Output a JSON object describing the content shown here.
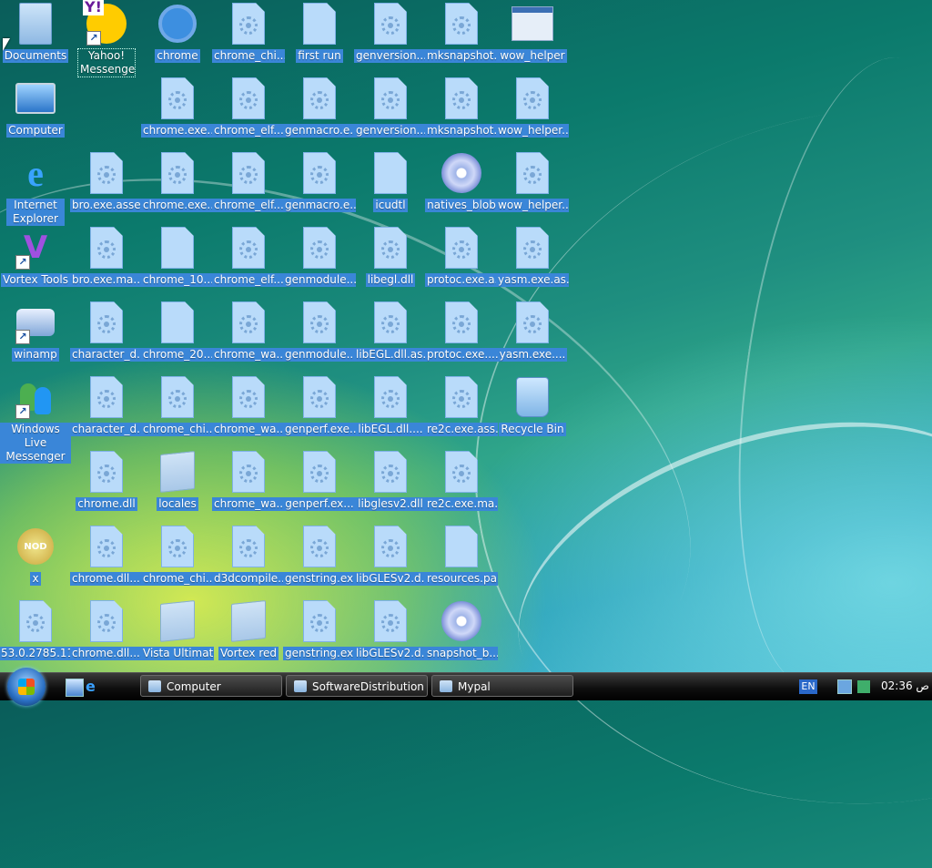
{
  "desktop_icons": [
    {
      "label": "Documents"
    },
    {
      "label": "Computer"
    },
    {
      "label": "Internet Explorer"
    },
    {
      "label": "Vortex Tools"
    },
    {
      "label": "winamp"
    },
    {
      "label": "Windows Live Messenger"
    },
    {
      "label": "x"
    },
    {
      "label": "53.0.2785.11..."
    },
    {
      "label": "Yahoo! Messenger"
    },
    {
      "label": "bro.exe.asse..."
    },
    {
      "label": "bro.exe.ma..."
    },
    {
      "label": "character_d..."
    },
    {
      "label": "character_d..."
    },
    {
      "label": "chrome.dll"
    },
    {
      "label": "chrome.dll...."
    },
    {
      "label": "chrome.dll...."
    },
    {
      "label": "chrome"
    },
    {
      "label": "chrome.exe...."
    },
    {
      "label": "chrome.exe...."
    },
    {
      "label": "chrome_10..."
    },
    {
      "label": "chrome_20..."
    },
    {
      "label": "chrome_chi..."
    },
    {
      "label": "locales"
    },
    {
      "label": "chrome_chi..."
    },
    {
      "label": "Vista Ultimate"
    },
    {
      "label": "chrome_chi..."
    },
    {
      "label": "chrome_elf...."
    },
    {
      "label": "chrome_elf...."
    },
    {
      "label": "chrome_elf...."
    },
    {
      "label": "chrome_wa..."
    },
    {
      "label": "chrome_wa..."
    },
    {
      "label": "chrome_wa..."
    },
    {
      "label": "d3dcompile..."
    },
    {
      "label": "Vortex red"
    },
    {
      "label": "first run"
    },
    {
      "label": "genmacro.e..."
    },
    {
      "label": "genmacro.e..."
    },
    {
      "label": "genmodule...."
    },
    {
      "label": "genmodule...."
    },
    {
      "label": "genperf.exe...."
    },
    {
      "label": "genperf.ex..."
    },
    {
      "label": "genstring.ex..."
    },
    {
      "label": "genstring.ex..."
    },
    {
      "label": "genversion...."
    },
    {
      "label": "genversion...."
    },
    {
      "label": "icudtl"
    },
    {
      "label": "libegl.dll"
    },
    {
      "label": "libEGL.dll.as..."
    },
    {
      "label": "libEGL.dll...."
    },
    {
      "label": "libglesv2.dll"
    },
    {
      "label": "libGLESv2.d..."
    },
    {
      "label": "libGLESv2.d..."
    },
    {
      "label": "mksnapshot..."
    },
    {
      "label": "mksnapshot..."
    },
    {
      "label": "natives_blob"
    },
    {
      "label": "protoc.exe.a..."
    },
    {
      "label": "protoc.exe...."
    },
    {
      "label": "re2c.exe.ass..."
    },
    {
      "label": "re2c.exe.ma..."
    },
    {
      "label": "resources.pak"
    },
    {
      "label": "snapshot_b..."
    },
    {
      "label": "wow_helper"
    },
    {
      "label": "wow_helper...."
    },
    {
      "label": "wow_helper...."
    },
    {
      "label": "yasm.exe.as..."
    },
    {
      "label": "yasm.exe...."
    },
    {
      "label": "Recycle Bin"
    }
  ],
  "taskbar": {
    "buttons": [
      {
        "label": "Computer"
      },
      {
        "label": "SoftwareDistribution"
      },
      {
        "label": "Mypal"
      }
    ],
    "language": "EN",
    "clock": "02:36 ص"
  }
}
